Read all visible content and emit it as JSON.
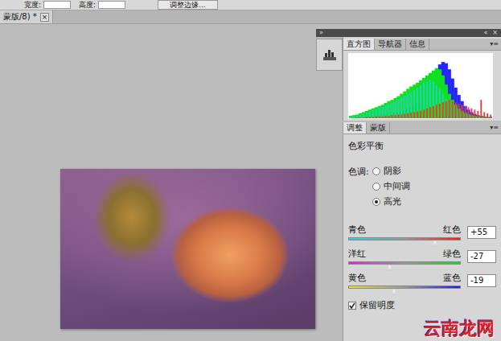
{
  "toolbar": {
    "items": [
      "宽度:",
      "高度:"
    ],
    "button": "调整边缘..."
  },
  "document_tab": {
    "label": "蒙版/8) *",
    "close": "×",
    "selected": true
  },
  "panel_header": {
    "left": "»",
    "right": "«",
    "close": "×"
  },
  "histogram_panel": {
    "tabs": [
      {
        "label": "直方图",
        "selected": true
      },
      {
        "label": "导航器",
        "selected": false
      },
      {
        "label": "信息",
        "selected": false
      }
    ],
    "menu": "▾≡",
    "chart": {
      "series": [
        {
          "color": "#2424ff",
          "values": [
            1,
            1,
            1,
            2,
            2,
            2,
            3,
            3,
            4,
            4,
            5,
            6,
            7,
            8,
            9,
            10,
            12,
            14,
            16,
            18,
            22,
            26,
            32,
            40,
            50,
            60,
            70,
            80,
            88,
            92,
            90,
            80,
            65,
            50,
            38,
            28,
            20,
            14,
            10,
            7,
            5,
            4,
            3,
            2,
            2
          ]
        },
        {
          "color": "#10e020",
          "values": [
            4,
            5,
            6,
            8,
            10,
            12,
            14,
            16,
            18,
            20,
            22,
            25,
            28,
            30,
            33,
            36,
            40,
            44,
            48,
            52,
            55,
            58,
            62,
            66,
            70,
            74,
            78,
            82,
            80,
            70,
            55,
            40,
            30,
            22,
            16,
            12,
            9,
            7,
            5,
            4,
            3,
            3,
            2,
            2,
            1
          ]
        },
        {
          "color": "#20d0d0",
          "values": [
            2,
            3,
            4,
            5,
            7,
            9,
            11,
            13,
            15,
            17,
            19,
            21,
            23,
            25,
            28,
            31,
            34,
            37,
            40,
            43,
            46,
            50,
            54,
            58,
            60,
            62,
            60,
            55,
            48,
            40,
            32,
            26,
            20,
            15,
            12,
            9,
            7,
            5,
            4,
            3,
            2,
            2,
            1,
            1,
            1
          ]
        },
        {
          "color": "#ff3030",
          "values": [
            0,
            0,
            1,
            1,
            1,
            2,
            2,
            2,
            3,
            3,
            3,
            4,
            4,
            5,
            5,
            6,
            6,
            7,
            8,
            9,
            10,
            11,
            12,
            14,
            16,
            18,
            20,
            22,
            24,
            26,
            28,
            30,
            28,
            26,
            24,
            22,
            20,
            18,
            16,
            14,
            12,
            30,
            10,
            8,
            6
          ]
        }
      ]
    }
  },
  "adjustments_panel": {
    "tabs": [
      {
        "label": "调整",
        "selected": true
      },
      {
        "label": "蒙版",
        "selected": false
      }
    ],
    "menu": "▾≡",
    "title": "色彩平衡",
    "tone_label": "色调:",
    "tones": [
      {
        "label": "阴影",
        "selected": false
      },
      {
        "label": "中间调",
        "selected": false
      },
      {
        "label": "高光",
        "selected": true
      }
    ],
    "sliders": [
      {
        "left": "青色",
        "right": "红色",
        "value": "+55",
        "level": 0.775
      },
      {
        "left": "洋红",
        "right": "绿色",
        "value": "-27",
        "level": 0.365
      },
      {
        "left": "黄色",
        "right": "蓝色",
        "value": "-19",
        "level": 0.405
      }
    ],
    "preserve": {
      "label": "保留明度",
      "checked": true
    }
  },
  "watermark": {
    "text": "云南龙网"
  }
}
